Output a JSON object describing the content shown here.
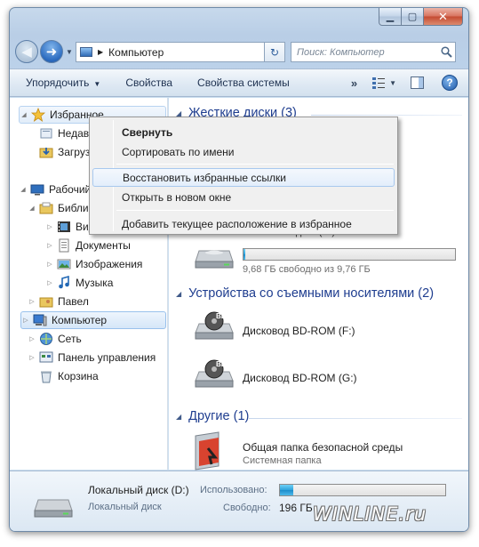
{
  "window": {
    "min_glyph": "▁",
    "max_glyph": "▢",
    "close_glyph": "✕"
  },
  "nav": {
    "back_glyph": "◀",
    "forward_glyph": "➜",
    "history_glyph": "▼",
    "address_sep": "▶",
    "address_text": "Компьютер",
    "address_drop": "▶",
    "refresh_glyph": "↻",
    "search_placeholder": "Поиск: Компьютер"
  },
  "toolbar": {
    "organize": "Упорядочить",
    "organize_caret": "▼",
    "properties": "Свойства",
    "system_properties": "Свойства системы",
    "more_glyph": "»",
    "view_caret": "▼",
    "help_glyph": "?"
  },
  "navpane": {
    "favorites": "Избранное",
    "fav_recent": "Недавние места",
    "fav_downloads": "Загрузки",
    "desktop": "Рабочий стол",
    "libraries": "Библиотеки",
    "lib_video": "Видео",
    "lib_docs": "Документы",
    "lib_images": "Изображения",
    "lib_music": "Музыка",
    "user": "Павел",
    "computer": "Компьютер",
    "network": "Сеть",
    "control_panel": "Панель управления",
    "recycle": "Корзина",
    "expand_glyph": "▷",
    "collapse_glyph": "◢"
  },
  "content": {
    "hdd_header": "Жесткие диски (3)",
    "group_caret": "◢",
    "drive_d_sub_partial": "Локальный диск (D:)",
    "drive_d_free": "9,68 ГБ свободно из 9,76 ГБ",
    "drive_d_fill": 0.01,
    "removable_header": "Устройства со съемными носителями (2)",
    "bd_f": "Дисковод BD-ROM (F:)",
    "bd_g": "Дисковод BD-ROM (G:)",
    "bd_label": "BD",
    "other_header": "Другие (1)",
    "shared_name": "Общая папка безопасной среды",
    "shared_sub": "Системная папка"
  },
  "details": {
    "name": "Локальный диск (D:)",
    "type": "Локальный диск",
    "used_label": "Использовано:",
    "used_fill": 0.08,
    "free_label": "Свободно:",
    "free_value": "196 ГБ"
  },
  "context_menu": {
    "collapse": "Свернуть",
    "sort_by_name": "Сортировать по имени",
    "restore_links": "Восстановить избранные ссылки",
    "open_new_window": "Открыть в новом окне",
    "add_location": "Добавить текущее расположение в избранное"
  },
  "watermark": "WINLINE.ru",
  "colors": {
    "accent": "#1e3d8f",
    "selection": "#d5e6f8",
    "bar_fill": "#2ca3dc"
  }
}
